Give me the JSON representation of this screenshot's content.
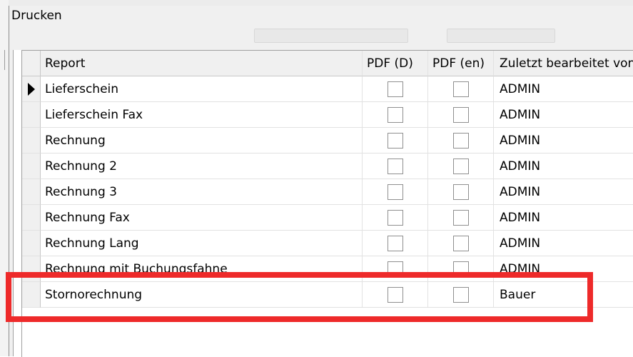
{
  "window": {
    "title": "Drucken"
  },
  "grid": {
    "columns": [
      "Report",
      "PDF (D)",
      "PDF (en)",
      "Zuletzt bearbeitet von"
    ],
    "rows": [
      {
        "report": "Lieferschein",
        "pdf_d": false,
        "pdf_en": false,
        "user": "ADMIN",
        "current": true
      },
      {
        "report": "Lieferschein Fax",
        "pdf_d": false,
        "pdf_en": false,
        "user": "ADMIN"
      },
      {
        "report": "Rechnung",
        "pdf_d": false,
        "pdf_en": false,
        "user": "ADMIN"
      },
      {
        "report": "Rechnung 2",
        "pdf_d": false,
        "pdf_en": false,
        "user": "ADMIN"
      },
      {
        "report": "Rechnung 3",
        "pdf_d": false,
        "pdf_en": false,
        "user": "ADMIN"
      },
      {
        "report": "Rechnung Fax",
        "pdf_d": false,
        "pdf_en": false,
        "user": "ADMIN"
      },
      {
        "report": "Rechnung Lang",
        "pdf_d": false,
        "pdf_en": false,
        "user": "ADMIN"
      },
      {
        "report": "Rechnung mit Buchungsfahne",
        "pdf_d": false,
        "pdf_en": false,
        "user": "ADMIN"
      },
      {
        "report": "Stornorechnung",
        "pdf_d": false,
        "pdf_en": false,
        "user": "Bauer"
      }
    ]
  },
  "annotation": {
    "color": "#ee2a2a",
    "highlighted_row": "Stornorechnung"
  },
  "icons": {
    "row_indicator": "current-row-arrow-icon"
  }
}
